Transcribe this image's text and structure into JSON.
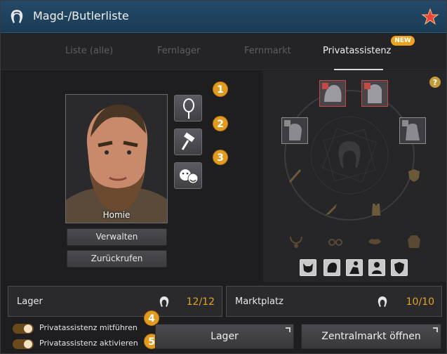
{
  "window": {
    "title": "Magd-/Butlerliste",
    "icon": "maid-icon",
    "favorite_icon": "star-icon"
  },
  "tabs": [
    {
      "label": "Liste (alle)",
      "active": false
    },
    {
      "label": "Fernlager",
      "active": false
    },
    {
      "label": "Fernmarkt",
      "active": false
    },
    {
      "label": "Privatassistenz",
      "active": true,
      "badge": "NEW"
    }
  ],
  "butler": {
    "name": "Homie",
    "actions": {
      "manage": "Verwalten",
      "recall": "Zurückrufen"
    },
    "side_buttons": [
      {
        "icon": "mirror-icon",
        "marker": "1"
      },
      {
        "icon": "hammer-icon",
        "marker": "2"
      },
      {
        "icon": "emotion-icon",
        "marker": "3"
      }
    ]
  },
  "equipment": {
    "help_icon": "question-icon",
    "top_slots": [
      "helmet-slot-red",
      "armor-slot-red"
    ],
    "side_slots": [
      "gloves-slot",
      "shoes-slot"
    ],
    "weapon_icons": [
      "sword-icon",
      "shield-icon",
      "dagger-icon",
      "vest-icon"
    ],
    "accessory_icons": [
      "necklace-icon",
      "glasses-icon",
      "lips-icon",
      "coat-icon"
    ],
    "bottom_slots": [
      "mask-icon",
      "hair-icon",
      "pose-icon",
      "bust-icon",
      "crest-icon"
    ]
  },
  "storage": {
    "lager": {
      "label": "Lager",
      "count": "12/12"
    },
    "marktplatz": {
      "label": "Marktplatz",
      "count": "10/10"
    }
  },
  "toggles": [
    {
      "label": "Privatassistenz mitführen",
      "marker": "4",
      "on": true
    },
    {
      "label": "Privatassistenz aktivieren",
      "marker": "5",
      "on": true
    }
  ],
  "buttons": {
    "lager": "Lager",
    "central_market": "Zentralmarkt öffnen"
  },
  "colors": {
    "accent": "#e29a1f",
    "titlebar": "#1f4260",
    "count": "#e3a326"
  }
}
